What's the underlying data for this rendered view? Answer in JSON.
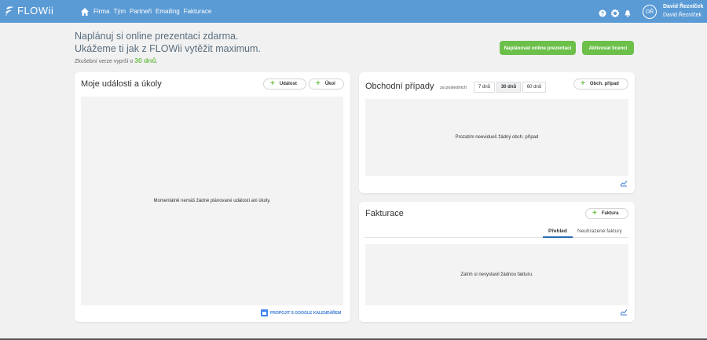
{
  "app": {
    "logo_text": "FLOWii",
    "nav": [
      "Firma",
      "Tým",
      "Partneři",
      "Emailing",
      "Fakturace"
    ],
    "user": {
      "initials": "DŘ",
      "name": "David Řezníček",
      "company": "David Řezníček"
    }
  },
  "promo": {
    "line1": "Naplánuj si online prezentaci zdarma.",
    "line2": "Ukážeme ti jak z FLOWii vytěžit maximum.",
    "trial_prefix": "Zkušební verze vyprší o",
    "trial_days": "30 dnů",
    "trial_suffix": ".",
    "btn_schedule": "Naplánovat online prezentaci",
    "btn_activate": "Aktivovat licenci"
  },
  "events": {
    "title": "Moje události a úkoly",
    "btn_event": "Událost",
    "btn_task": "Úkol",
    "empty_text": "Momentálně nemáš žádné plánované události ani úkoly.",
    "gcal_link": "PROPOJIT S GOOGLE KALENDÁŘEM"
  },
  "deals": {
    "title": "Obchodní případy",
    "period_label": "za posledních",
    "periods": [
      "7 dnů",
      "30 dnů",
      "60 dnů"
    ],
    "btn_new": "Obch. případ",
    "empty_text": "Prozatím neevidueš žádný obch. případ"
  },
  "invoices": {
    "title": "Fakturace",
    "btn_new": "Faktura",
    "tabs": [
      "Přehled",
      "Neuhrazené faktury"
    ],
    "empty_text": "Zatím si nevystavil žádnou fakturu."
  }
}
